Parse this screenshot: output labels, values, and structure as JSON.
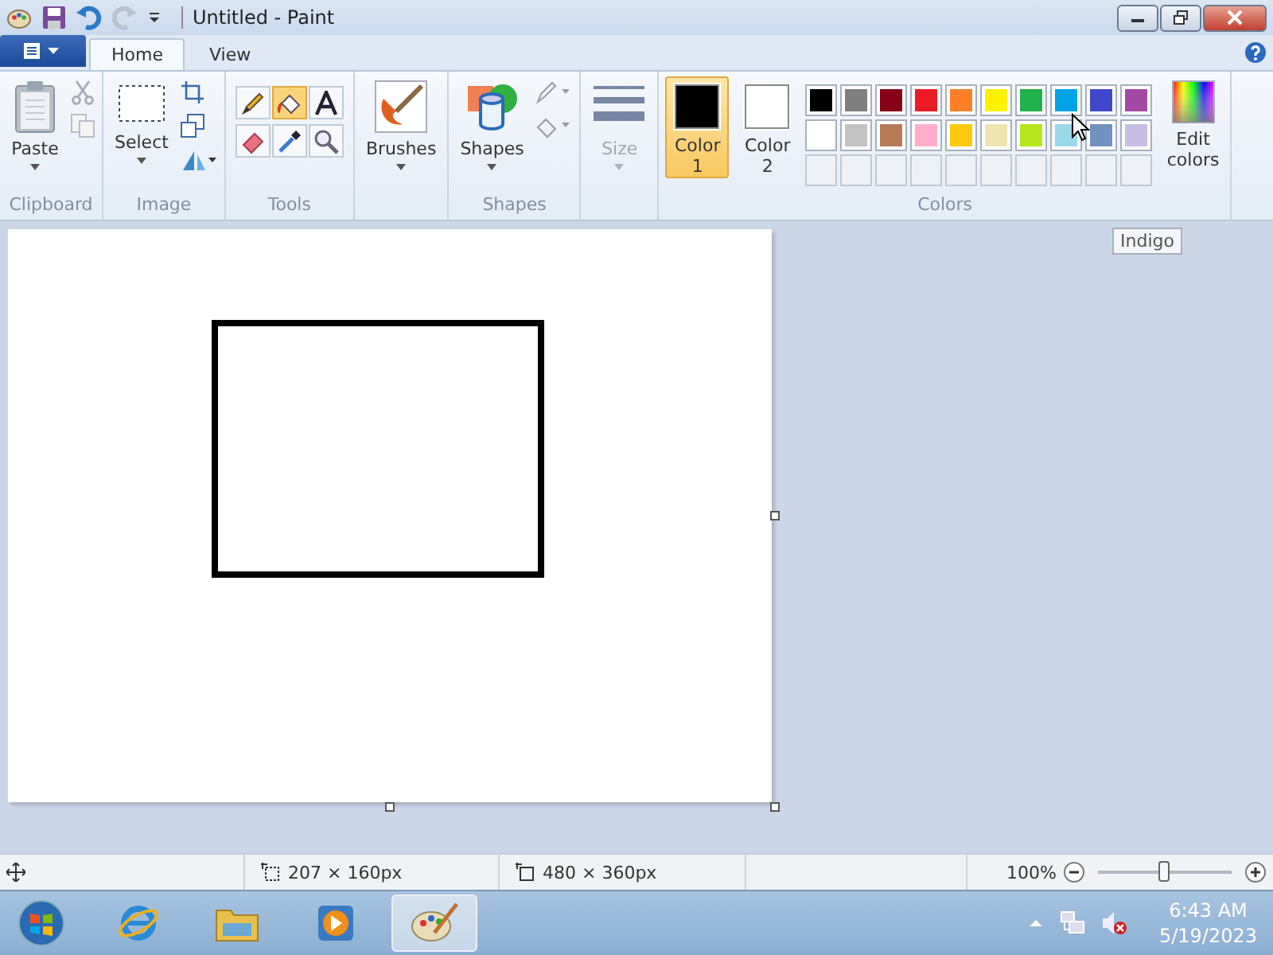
{
  "window": {
    "title": "Untitled - Paint"
  },
  "tabs": [
    {
      "label": "Home",
      "selected": true
    },
    {
      "label": "View",
      "selected": false
    }
  ],
  "ribbon": {
    "clipboard": {
      "paste": "Paste",
      "group": "Clipboard"
    },
    "image": {
      "select": "Select",
      "group": "Image"
    },
    "tools": {
      "group": "Tools",
      "items": [
        {
          "kind": "pencil",
          "selected": false
        },
        {
          "kind": "fill",
          "selected": true
        },
        {
          "kind": "text",
          "selected": false
        },
        {
          "kind": "eraser",
          "selected": false
        },
        {
          "kind": "picker",
          "selected": false
        },
        {
          "kind": "magnifier",
          "selected": false
        }
      ]
    },
    "brushes": {
      "label": "Brushes"
    },
    "shapes": {
      "label": "Shapes",
      "group": "Shapes"
    },
    "size": {
      "label": "Size",
      "disabled": true
    },
    "colors": {
      "group": "Colors",
      "slots": [
        {
          "label": "Color",
          "sub": "1",
          "color": "#000000",
          "selected": true
        },
        {
          "label": "Color",
          "sub": "2",
          "color": "#ffffff",
          "selected": false
        }
      ],
      "palette": [
        {
          "kind": "swatch",
          "color": "#000000"
        },
        {
          "kind": "swatch",
          "color": "#7f7f7f"
        },
        {
          "kind": "swatch",
          "color": "#880015"
        },
        {
          "kind": "swatch",
          "color": "#ed1c24"
        },
        {
          "kind": "swatch",
          "color": "#ff7f27"
        },
        {
          "kind": "swatch",
          "color": "#fff200"
        },
        {
          "kind": "swatch",
          "color": "#22b14c"
        },
        {
          "kind": "swatch",
          "color": "#00a2e8"
        },
        {
          "kind": "swatch",
          "color": "#3f48cc"
        },
        {
          "kind": "swatch",
          "color": "#a349a4"
        },
        {
          "kind": "swatch",
          "color": "#ffffff"
        },
        {
          "kind": "swatch",
          "color": "#c3c3c3"
        },
        {
          "kind": "swatch",
          "color": "#b97a57"
        },
        {
          "kind": "swatch",
          "color": "#ffaec9"
        },
        {
          "kind": "swatch",
          "color": "#ffc90e"
        },
        {
          "kind": "swatch",
          "color": "#efe4b0"
        },
        {
          "kind": "swatch",
          "color": "#b5e61d"
        },
        {
          "kind": "swatch",
          "color": "#99d9ea"
        },
        {
          "kind": "swatch",
          "color": "#7092be"
        },
        {
          "kind": "swatch",
          "color": "#c8bfe7"
        },
        {
          "kind": "empty"
        },
        {
          "kind": "empty"
        },
        {
          "kind": "empty"
        },
        {
          "kind": "empty"
        },
        {
          "kind": "empty"
        },
        {
          "kind": "empty"
        },
        {
          "kind": "empty"
        },
        {
          "kind": "empty"
        },
        {
          "kind": "empty"
        },
        {
          "kind": "empty"
        }
      ],
      "edit": {
        "line1": "Edit",
        "line2": "colors"
      }
    }
  },
  "tooltip": "Indigo",
  "status_bar": {
    "selection": "207 × 160px",
    "canvas_size": "480 × 360px",
    "zoom": "100%",
    "zoom_slider": {
      "level": 0.5
    }
  },
  "taskbar": {
    "apps": [
      {
        "kind": "browser",
        "selected": false
      },
      {
        "kind": "folder",
        "selected": false
      },
      {
        "kind": "media",
        "selected": false
      },
      {
        "kind": "paint",
        "selected": true
      }
    ],
    "time": "6:43 AM",
    "date": "5/19/2023"
  }
}
